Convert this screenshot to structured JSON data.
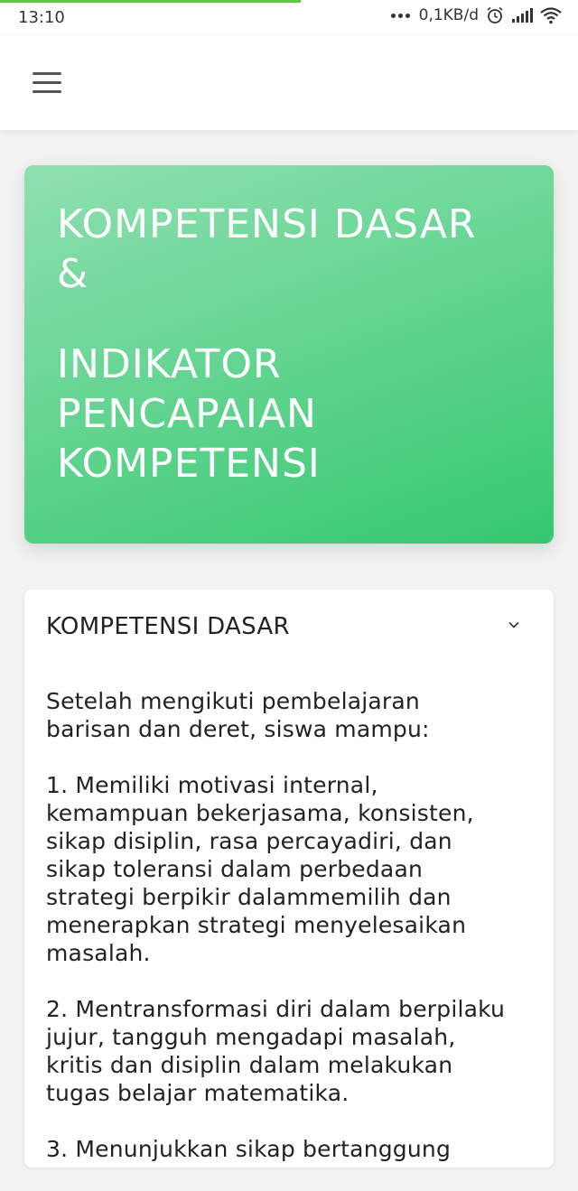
{
  "status_bar": {
    "time": "13:10",
    "net_speed": "0,1KB/d",
    "page_load_progress": 0.52
  },
  "app_bar": {
    "menu_icon": "hamburger-menu-icon"
  },
  "hero": {
    "line1": "KOMPETENSI DASAR",
    "line2": "&",
    "line3": "INDIKATOR",
    "line4": "PENCAPAIAN",
    "line5": "KOMPETENSI",
    "gradient_start": "#8fe0b0",
    "gradient_end": "#35c86f"
  },
  "accordion": {
    "title": "KOMPETENSI DASAR",
    "icon": "chevron-down-icon",
    "intro": "Setelah mengikuti pembelajaran\nbarisan dan deret, siswa mampu:",
    "item1": "1. Memiliki motivasi internal,\nkemampuan bekerjasama, konsisten,\nsikap disiplin, rasa percayadiri, dan\nsikap toleransi dalam perbedaan\nstrategi berpikir dalammemilih dan\nmenerapkan strategi menyelesaikan\nmasalah.",
    "item2": "2. Mentransformasi diri dalam berpilaku\njujur, tangguh mengadapi masalah,\nkritis dan disiplin dalam melakukan\ntugas belajar matematika.",
    "item3": "3. Menunjukkan sikap bertanggung"
  }
}
